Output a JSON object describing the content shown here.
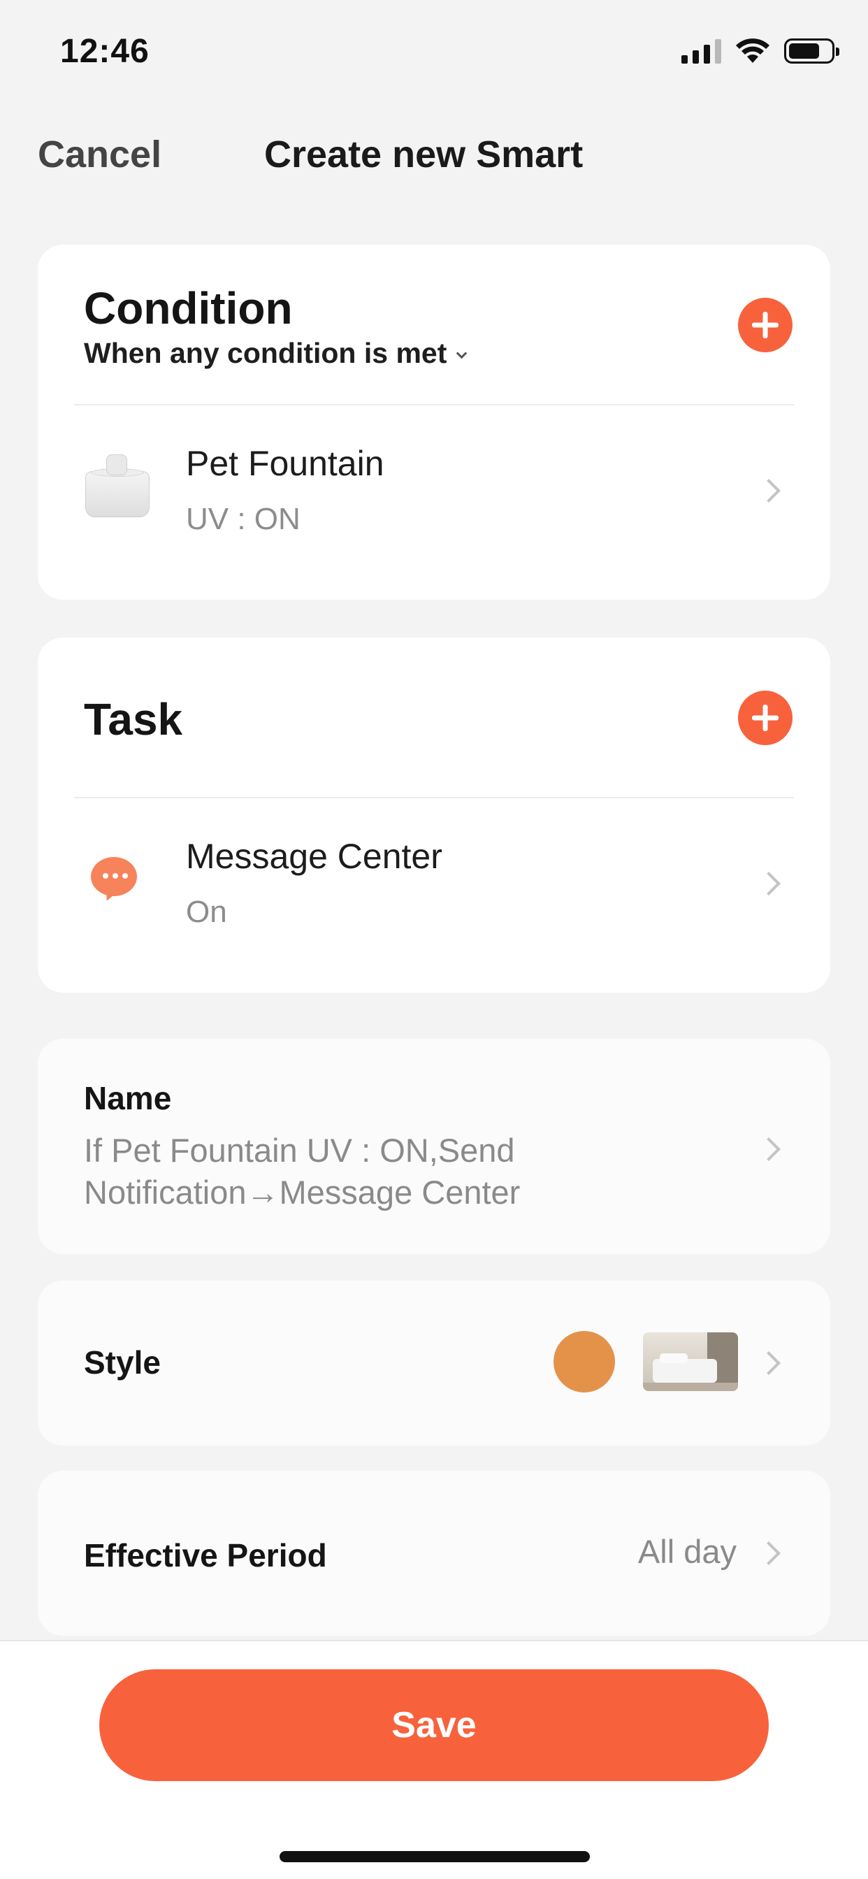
{
  "status_bar": {
    "time": "12:46"
  },
  "nav": {
    "cancel_label": "Cancel",
    "title": "Create new Smart"
  },
  "condition": {
    "title": "Condition",
    "mode_label": "When any condition is met",
    "items": [
      {
        "device": "Pet Fountain",
        "state": "UV : ON",
        "icon": "pet-fountain-thumbnail"
      }
    ]
  },
  "task": {
    "title": "Task",
    "items": [
      {
        "name": "Message Center",
        "state": "On",
        "icon": "message-center-icon"
      }
    ]
  },
  "name_section": {
    "label": "Name",
    "value": "If Pet Fountain UV : ON,Send Notification→Message Center"
  },
  "style_section": {
    "label": "Style",
    "color": "#e4924a",
    "image": "bedroom-photo"
  },
  "period_section": {
    "label": "Effective Period",
    "value": "All day"
  },
  "save_label": "Save",
  "colors": {
    "accent": "#f7623c",
    "background": "#f3f3f3"
  }
}
